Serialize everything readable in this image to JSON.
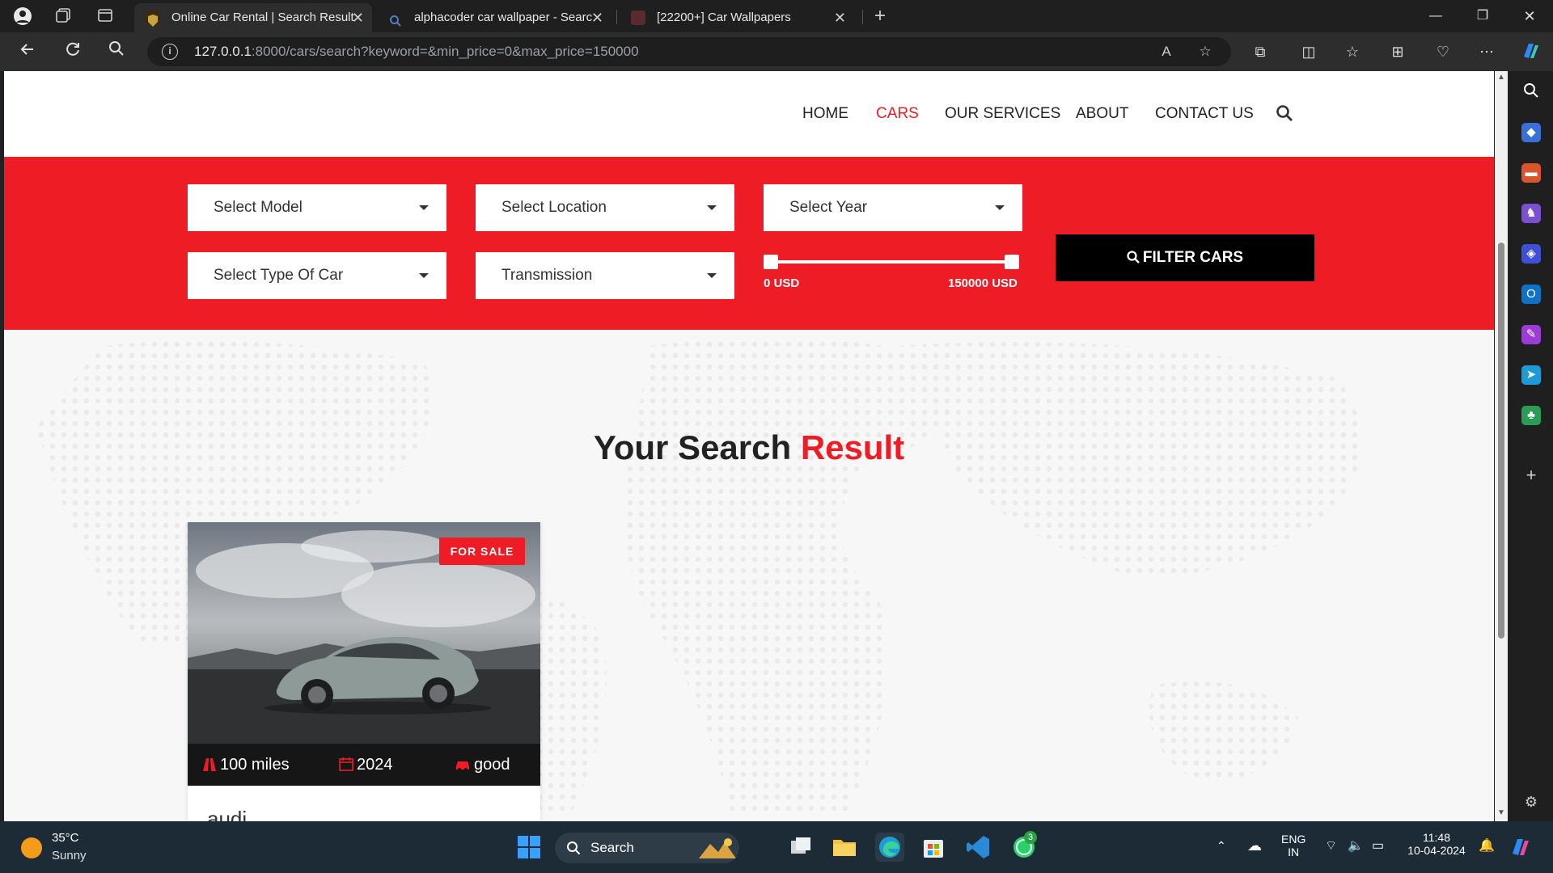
{
  "browser": {
    "tabs": [
      {
        "title": "Online Car Rental | Search Result",
        "active": true
      },
      {
        "title": "alphacoder car wallpaper - Searc",
        "active": false
      },
      {
        "title": "[22200+] Car Wallpapers",
        "active": false
      }
    ],
    "url": {
      "host": "127.0.0.1",
      "rest": ":8000/cars/search?keyword=&min_price=0&max_price=150000"
    }
  },
  "site": {
    "nav": {
      "home": "HOME",
      "cars": "CARS",
      "services": "OUR SERVICES",
      "about": "ABOUT",
      "contact": "CONTACT US"
    },
    "filters": {
      "model": "Select Model",
      "location": "Select Location",
      "year": "Select Year",
      "type": "Select Type Of Car",
      "transmission": "Transmission",
      "price_min": "0 USD",
      "price_max": "150000 USD",
      "button": "FILTER CARS"
    },
    "results": {
      "title_main": "Your Search",
      "title_accent": "Result"
    },
    "car": {
      "badge": "FOR SALE",
      "miles": "100 miles",
      "year": "2024",
      "condition": "good",
      "name": "audi"
    }
  },
  "taskbar": {
    "temperature": "35°C",
    "condition": "Sunny",
    "search": "Search",
    "whatsapp_badge": "3",
    "lang_line1": "ENG",
    "lang_line2": "IN",
    "time": "11:48",
    "date": "10-04-2024"
  },
  "colors": {
    "accent": "#ee1c25",
    "dark": "#161616"
  }
}
